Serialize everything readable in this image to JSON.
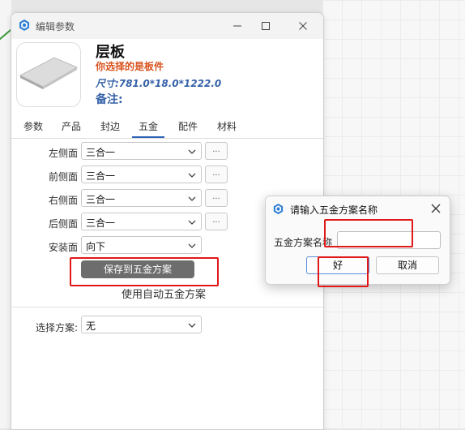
{
  "main_window": {
    "title": "编辑参数",
    "item_name": "层板",
    "selected_text": "你选择的是板件",
    "size_text": "尺寸:781.0*18.0*1222.0",
    "note_label": "备注:"
  },
  "tabs": [
    {
      "label": "参数"
    },
    {
      "label": "产品"
    },
    {
      "label": "封边"
    },
    {
      "label": "五金",
      "active": true
    },
    {
      "label": "配件"
    },
    {
      "label": "材料"
    }
  ],
  "hardware_rows": [
    {
      "label": "左侧面",
      "value": "三合一",
      "has_more": true
    },
    {
      "label": "前侧面",
      "value": "三合一",
      "has_more": true
    },
    {
      "label": "右侧面",
      "value": "三合一",
      "has_more": true
    },
    {
      "label": "后侧面",
      "value": "三合一",
      "has_more": true
    },
    {
      "label": "安装面",
      "value": "向下",
      "has_more": false
    }
  ],
  "more_button_label": "...",
  "save_button_label": "保存到五金方案",
  "auto_link_label": "使用自动五金方案",
  "scheme": {
    "label": "选择方案:",
    "value": "无"
  },
  "dialog": {
    "title": "请输入五金方案名称",
    "field_label": "五金方案名称",
    "field_value": "",
    "ok_label": "好",
    "cancel_label": "取消"
  },
  "colors": {
    "accent": "#2f63b8",
    "highlight_box": "#e01818",
    "selected_text": "#d9531e",
    "size_text": "#3561a8"
  }
}
